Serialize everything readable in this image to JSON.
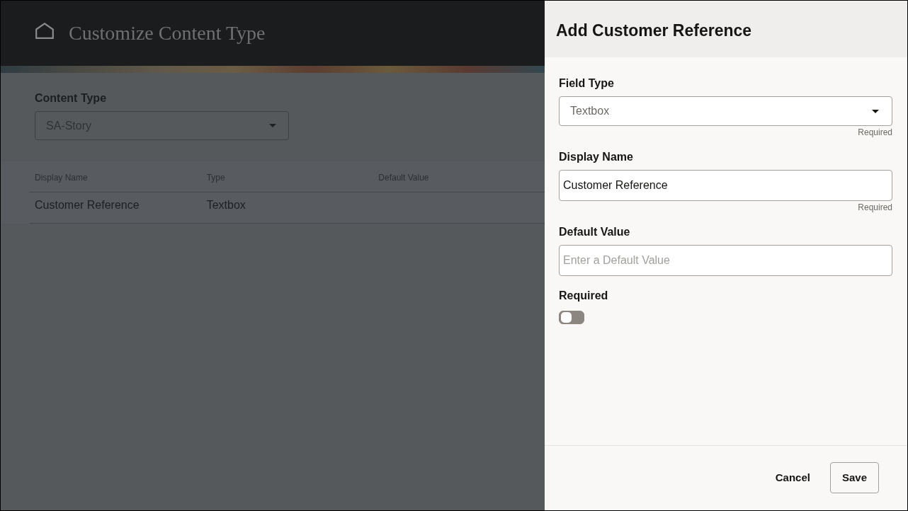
{
  "page": {
    "title": "Customize Content Type",
    "content_type": {
      "label": "Content Type",
      "value": "SA-Story"
    },
    "table": {
      "columns": [
        "Display Name",
        "Type",
        "Default Value"
      ],
      "rows": [
        {
          "cells": [
            "Customer Reference",
            "Textbox"
          ]
        }
      ]
    }
  },
  "drawer": {
    "title": "Add Customer Reference",
    "fields": [
      {
        "kind": "select",
        "label": "Field Type",
        "value": "Textbox",
        "helper_text": "Required"
      },
      {
        "kind": "text",
        "label": "Display Name",
        "value": "Customer Reference",
        "helper_text": "Required"
      },
      {
        "kind": "text",
        "label": "Default Value",
        "placeholder": "Enter a Default Value"
      },
      {
        "kind": "toggle",
        "label": "Required",
        "on": false
      }
    ],
    "buttons": [
      {
        "kind": "text",
        "label": "Cancel"
      },
      {
        "kind": "outlined",
        "label": "Save"
      }
    ]
  }
}
